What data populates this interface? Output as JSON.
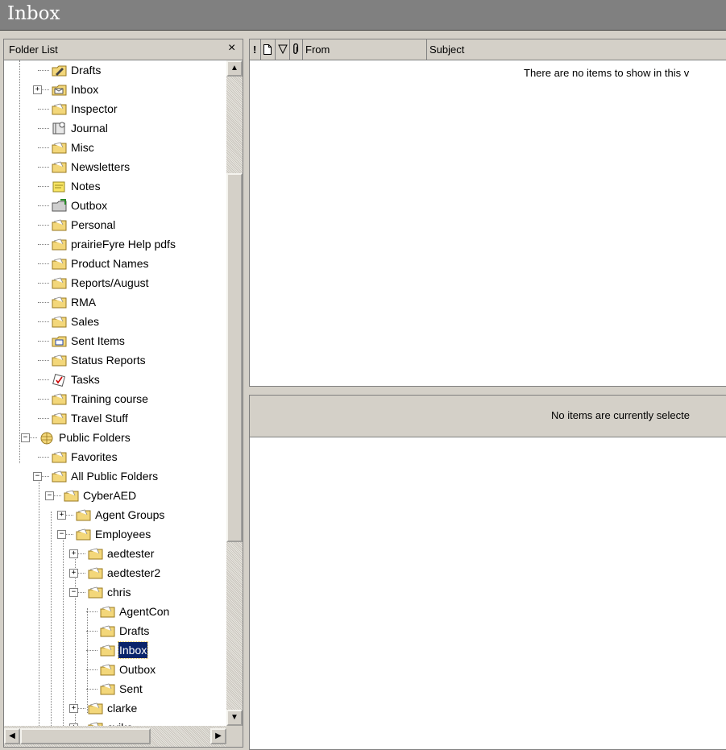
{
  "window": {
    "title": "Inbox"
  },
  "folder_pane": {
    "header": "Folder List",
    "close_symbol": "×",
    "items": [
      {
        "label": "Drafts",
        "level": 0,
        "icon": "drafts-icon",
        "expander": ""
      },
      {
        "label": "Inbox",
        "level": 0,
        "icon": "inbox-icon",
        "expander": "+"
      },
      {
        "label": "Inspector",
        "level": 0,
        "icon": "folder-icon",
        "expander": ""
      },
      {
        "label": "Journal",
        "level": 0,
        "icon": "journal-icon",
        "expander": ""
      },
      {
        "label": "Misc",
        "level": 0,
        "icon": "folder-icon",
        "expander": ""
      },
      {
        "label": "Newsletters",
        "level": 0,
        "icon": "folder-icon",
        "expander": ""
      },
      {
        "label": "Notes",
        "level": 0,
        "icon": "notes-icon",
        "expander": ""
      },
      {
        "label": "Outbox",
        "level": 0,
        "icon": "outbox-icon",
        "expander": ""
      },
      {
        "label": "Personal",
        "level": 0,
        "icon": "folder-icon",
        "expander": ""
      },
      {
        "label": "prairieFyre Help pdfs",
        "level": 0,
        "icon": "folder-icon",
        "expander": ""
      },
      {
        "label": "Product Names",
        "level": 0,
        "icon": "folder-icon",
        "expander": ""
      },
      {
        "label": "Reports/August",
        "level": 0,
        "icon": "folder-icon",
        "expander": ""
      },
      {
        "label": "RMA",
        "level": 0,
        "icon": "folder-icon",
        "expander": ""
      },
      {
        "label": "Sales",
        "level": 0,
        "icon": "folder-icon",
        "expander": ""
      },
      {
        "label": "Sent Items",
        "level": 0,
        "icon": "sent-items-icon",
        "expander": ""
      },
      {
        "label": "Status Reports",
        "level": 0,
        "icon": "folder-icon",
        "expander": ""
      },
      {
        "label": "Tasks",
        "level": 0,
        "icon": "tasks-icon",
        "expander": ""
      },
      {
        "label": "Training course",
        "level": 0,
        "icon": "folder-icon",
        "expander": ""
      },
      {
        "label": "Travel Stuff",
        "level": 0,
        "icon": "folder-icon",
        "expander": ""
      },
      {
        "label": "Public Folders",
        "level": -1,
        "icon": "public-folders-icon",
        "expander": "−"
      },
      {
        "label": "Favorites",
        "level": 0,
        "icon": "folder-icon",
        "expander": ""
      },
      {
        "label": "All Public Folders",
        "level": 0,
        "icon": "folder-icon",
        "expander": "−"
      },
      {
        "label": "CyberAED",
        "level": 1,
        "icon": "folder-icon",
        "expander": "−"
      },
      {
        "label": "Agent Groups",
        "level": 2,
        "icon": "folder-icon",
        "expander": "+"
      },
      {
        "label": "Employees",
        "level": 2,
        "icon": "folder-icon",
        "expander": "−"
      },
      {
        "label": "aedtester",
        "level": 3,
        "icon": "folder-icon",
        "expander": "+"
      },
      {
        "label": "aedtester2",
        "level": 3,
        "icon": "folder-icon",
        "expander": "+"
      },
      {
        "label": "chris",
        "level": 3,
        "icon": "folder-icon",
        "expander": "−"
      },
      {
        "label": "AgentCon",
        "level": 4,
        "icon": "folder-icon",
        "expander": ""
      },
      {
        "label": "Drafts",
        "level": 4,
        "icon": "folder-icon",
        "expander": ""
      },
      {
        "label": "Inbox",
        "level": 4,
        "icon": "folder-icon",
        "expander": "",
        "selected": true
      },
      {
        "label": "Outbox",
        "level": 4,
        "icon": "folder-icon",
        "expander": ""
      },
      {
        "label": "Sent",
        "level": 4,
        "icon": "folder-icon",
        "expander": ""
      },
      {
        "label": "clarke",
        "level": 3,
        "icon": "folder-icon",
        "expander": "+"
      },
      {
        "label": "cvike",
        "level": 3,
        "icon": "folder-icon",
        "expander": "+"
      }
    ]
  },
  "message_list": {
    "columns": [
      {
        "name": "importance-column",
        "label": "!"
      },
      {
        "name": "icon-column",
        "label": ""
      },
      {
        "name": "flag-column",
        "label": ""
      },
      {
        "name": "attachment-column",
        "label": ""
      },
      {
        "name": "from-column",
        "label": "From"
      },
      {
        "name": "subject-column",
        "label": "Subject"
      }
    ],
    "empty_text": "There are no items to show in this v"
  },
  "reading_pane": {
    "empty_text": "No items are currently selecte"
  },
  "colors": {
    "selection": "#0a246a",
    "title_bar": "#808080",
    "chrome": "#d4d0c8"
  }
}
